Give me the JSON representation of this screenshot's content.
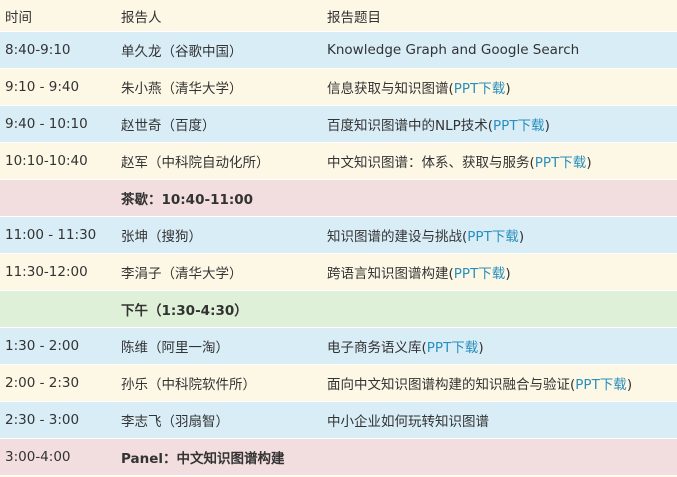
{
  "header": {
    "time": "时间",
    "speaker": "报告人",
    "title": "报告题目"
  },
  "rows": [
    {
      "time": "8:40-9:10",
      "speaker": "单久龙（谷歌中国）",
      "title": "Knowledge Graph and Google Search",
      "link": "",
      "suffix": ""
    },
    {
      "time": "9:10 - 9:40",
      "speaker": "朱小燕（清华大学）",
      "title": "信息获取与知识图谱(",
      "link": "PPT下载",
      "suffix": ")"
    },
    {
      "time": "9:40 - 10:10",
      "speaker": "赵世奇（百度）",
      "title": "百度知识图谱中的NLP技术(",
      "link": "PPT下载",
      "suffix": ")"
    },
    {
      "time": "10:10-10:40",
      "speaker": "赵军（中科院自动化所）",
      "title": "中文知识图谱：体系、获取与服务(",
      "link": "PPT下载",
      "suffix": ")"
    },
    {
      "time": "",
      "speaker": "茶歇：10:40-11:00",
      "title": "",
      "link": "",
      "suffix": ""
    },
    {
      "time": "11:00 - 11:30",
      "speaker": "张坤（搜狗）",
      "title": "知识图谱的建设与挑战(",
      "link": "PPT下载",
      "suffix": ")"
    },
    {
      "time": "11:30-12:00",
      "speaker": "李涓子（清华大学）",
      "title": "跨语言知识图谱构建(",
      "link": "PPT下载",
      "suffix": ")"
    },
    {
      "time": "",
      "speaker": "下午（1:30-4:30）",
      "title": "",
      "link": "",
      "suffix": ""
    },
    {
      "time": "1:30 - 2:00",
      "speaker": "陈维（阿里一淘）",
      "title": "电子商务语义库(",
      "link": "PPT下载",
      "suffix": ")"
    },
    {
      "time": "2:00 - 2:30",
      "speaker": "孙乐（中科院软件所）",
      "title": "面向中文知识图谱构建的知识融合与验证(",
      "link": "PPT下载",
      "suffix": ")"
    },
    {
      "time": "2:30 - 3:00",
      "speaker": "李志飞（羽扇智）",
      "title": "中小企业如何玩转知识图谱",
      "link": "",
      "suffix": ""
    },
    {
      "time": "3:00-4:00",
      "speaker": "Panel：中文知识图谱构建",
      "title": "",
      "link": "",
      "suffix": ""
    }
  ]
}
